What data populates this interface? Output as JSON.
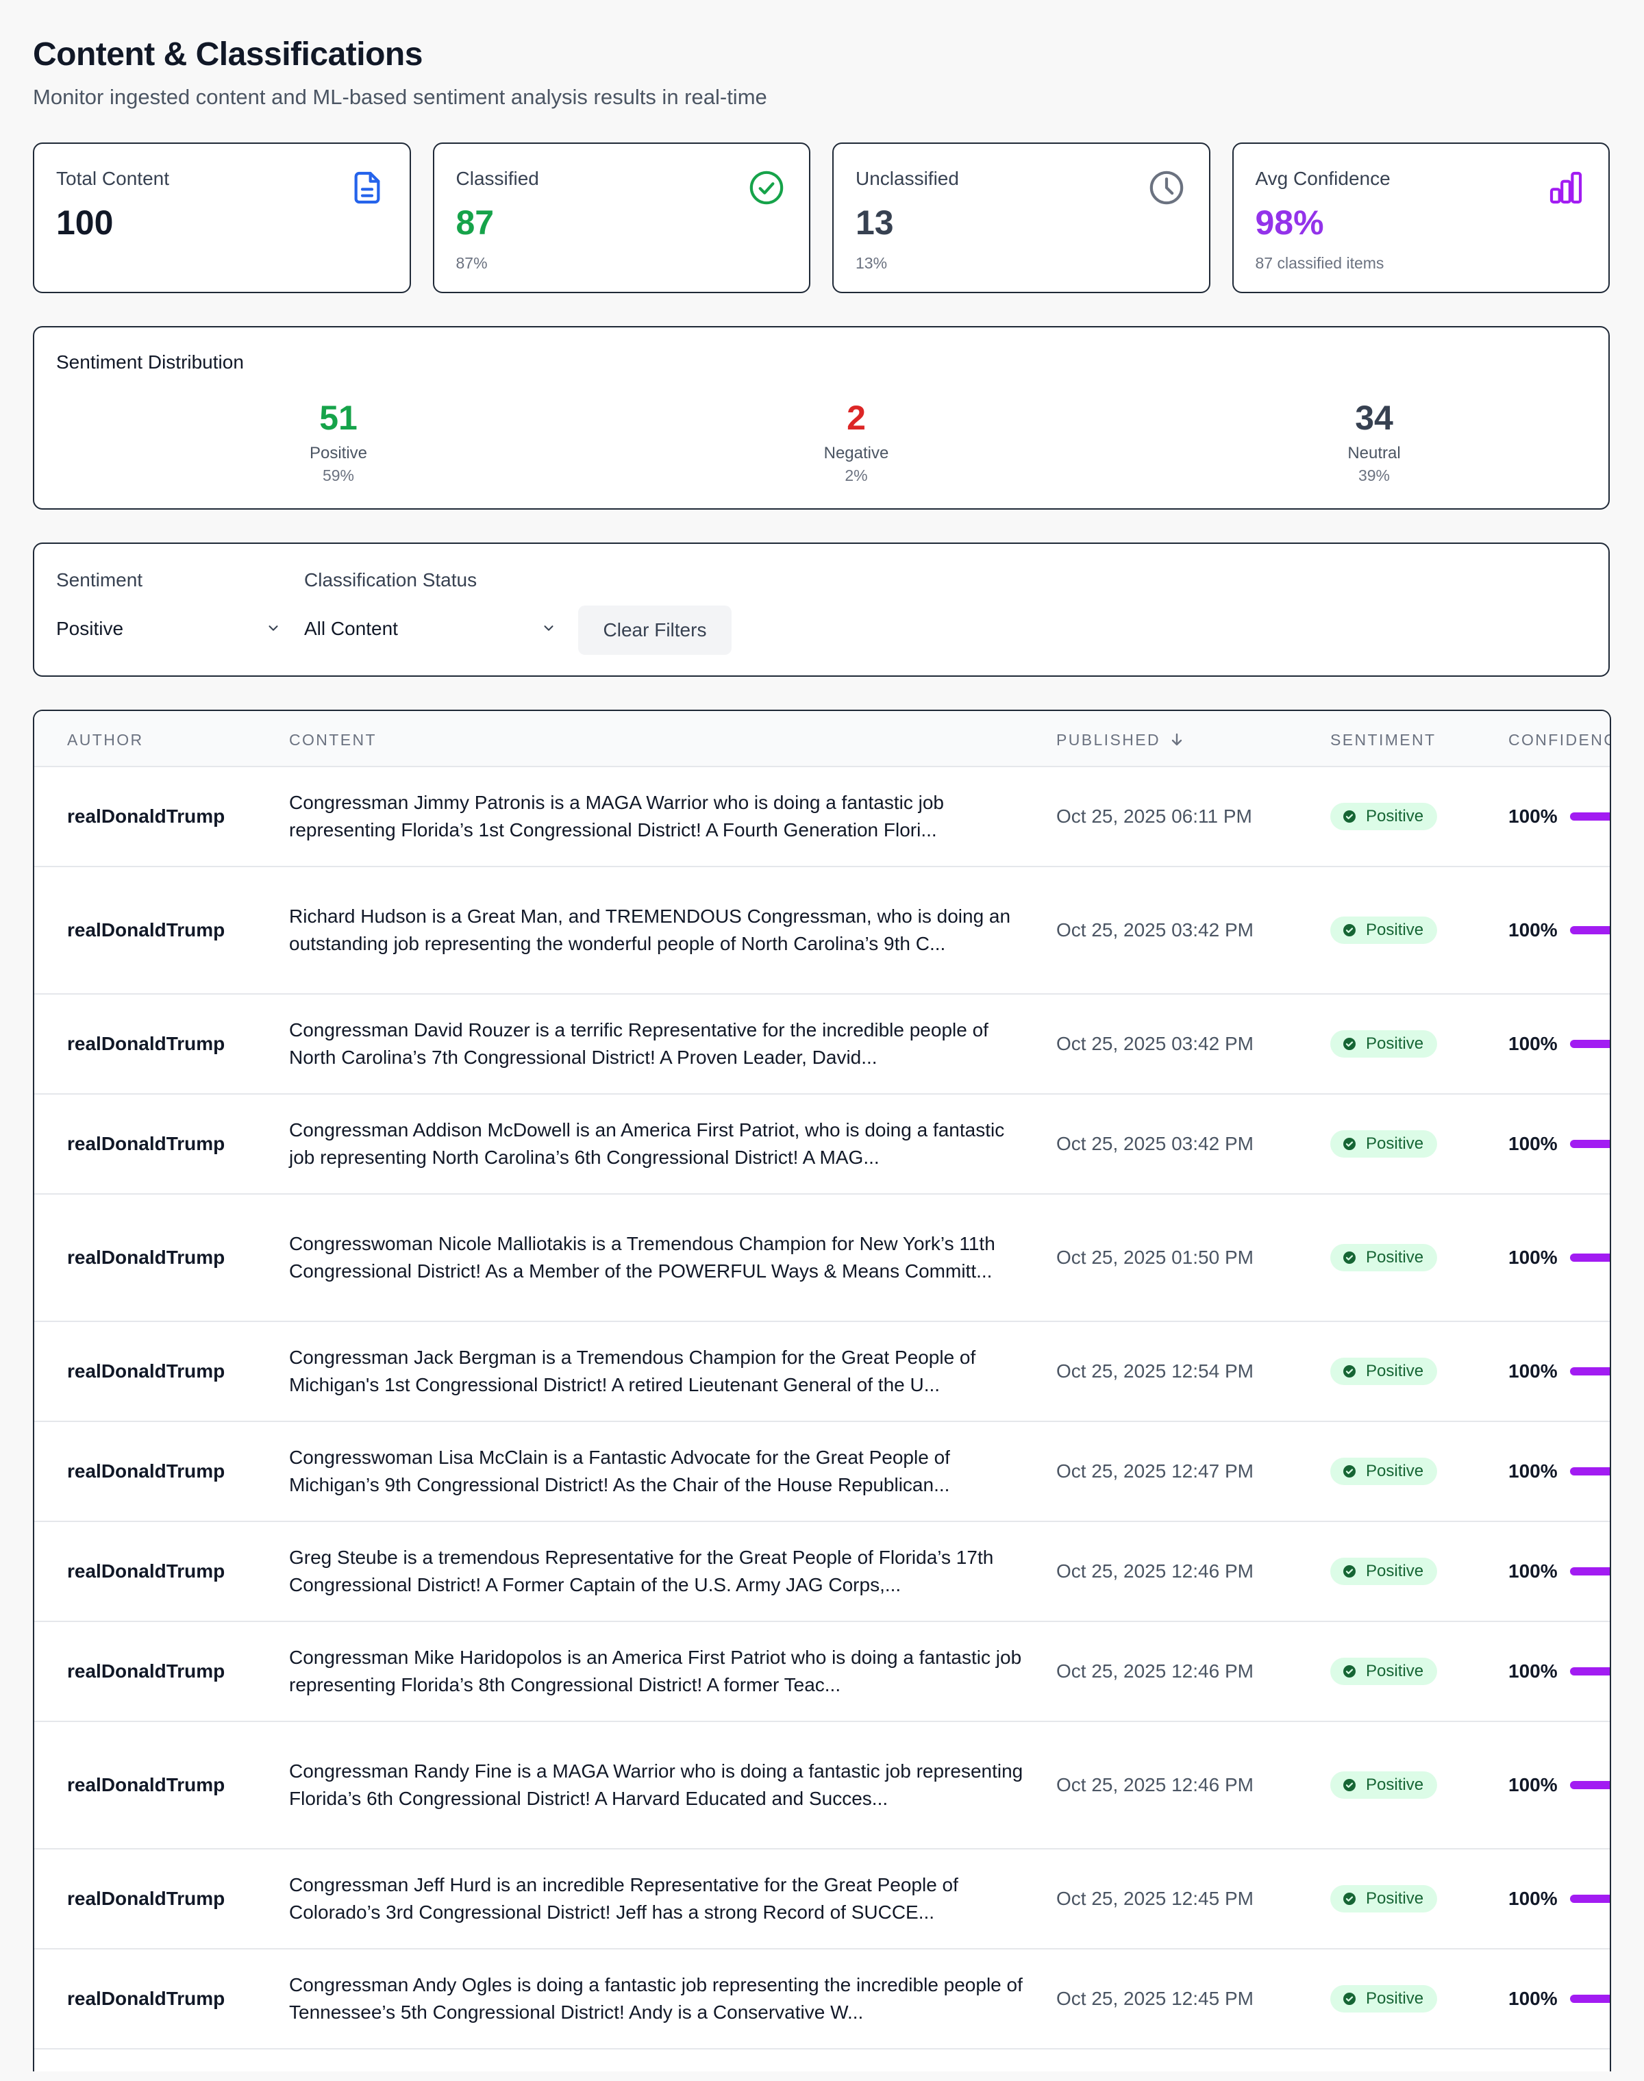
{
  "header": {
    "title": "Content & Classifications",
    "subtitle": "Monitor ingested content and ML-based sentiment analysis results in real-time"
  },
  "stats": [
    {
      "label": "Total Content",
      "value": "100",
      "sub": "",
      "color": "#111827",
      "icon": "document-icon"
    },
    {
      "label": "Classified",
      "value": "87",
      "sub": "87%",
      "color": "#16a34a",
      "icon": "check-circle-icon"
    },
    {
      "label": "Unclassified",
      "value": "13",
      "sub": "13%",
      "color": "#374151",
      "icon": "clock-icon"
    },
    {
      "label": "Avg Confidence",
      "value": "98%",
      "sub": "87 classified items",
      "color": "#9333ea",
      "icon": "bar-chart-icon"
    }
  ],
  "distribution": {
    "title": "Sentiment Distribution",
    "items": [
      {
        "value": "51",
        "label": "Positive",
        "pct": "59%",
        "color": "#16a34a"
      },
      {
        "value": "2",
        "label": "Negative",
        "pct": "2%",
        "color": "#dc2626"
      },
      {
        "value": "34",
        "label": "Neutral",
        "pct": "39%",
        "color": "#374151"
      }
    ]
  },
  "filters": {
    "sentiment_label": "Sentiment",
    "sentiment_value": "Positive",
    "status_label": "Classification Status",
    "status_value": "All Content",
    "clear_label": "Clear Filters"
  },
  "table": {
    "columns": {
      "author": "AUTHOR",
      "content": "CONTENT",
      "published": "PUBLISHED",
      "sentiment": "SENTIMENT",
      "confidence": "CONFIDENCE"
    },
    "rows": [
      {
        "author": "realDonaldTrump",
        "content": "Congressman Jimmy Patronis is a MAGA Warrior who is doing a fantastic job representing Florida’s 1st Congressional District! A Fourth Generation Flori...",
        "published": "Oct 25, 2025 06:11 PM",
        "sentiment": "Positive",
        "confidence": "100%"
      },
      {
        "author": "realDonaldTrump",
        "content": "Richard Hudson is a Great Man, and TREMENDOUS Congressman, who is doing an outstanding job representing the wonderful people of North Carolina’s 9th C...",
        "published": "Oct 25, 2025 03:42 PM",
        "sentiment": "Positive",
        "confidence": "100%"
      },
      {
        "author": "realDonaldTrump",
        "content": "Congressman David Rouzer is a terrific Representative for the incredible people of North Carolina’s 7th Congressional District! A Proven Leader, David...",
        "published": "Oct 25, 2025 03:42 PM",
        "sentiment": "Positive",
        "confidence": "100%"
      },
      {
        "author": "realDonaldTrump",
        "content": "Congressman Addison McDowell is an America First Patriot, who is doing a fantastic job representing North Carolina’s 6th Congressional District! A MAG...",
        "published": "Oct 25, 2025 03:42 PM",
        "sentiment": "Positive",
        "confidence": "100%"
      },
      {
        "author": "realDonaldTrump",
        "content": "Congresswoman Nicole Malliotakis is a Tremendous Champion for New York’s 11th Congressional District! As a Member of the POWERFUL Ways & Means Committ...",
        "published": "Oct 25, 2025 01:50 PM",
        "sentiment": "Positive",
        "confidence": "100%"
      },
      {
        "author": "realDonaldTrump",
        "content": "Congressman Jack Bergman is a Tremendous Champion for the Great People of Michigan's 1st Congressional District! A retired Lieutenant General of the U...",
        "published": "Oct 25, 2025 12:54 PM",
        "sentiment": "Positive",
        "confidence": "100%"
      },
      {
        "author": "realDonaldTrump",
        "content": "Congresswoman Lisa McClain is a Fantastic Advocate for the Great People of Michigan’s 9th Congressional District! As the Chair of the House Republican...",
        "published": "Oct 25, 2025 12:47 PM",
        "sentiment": "Positive",
        "confidence": "100%"
      },
      {
        "author": "realDonaldTrump",
        "content": "Greg Steube is a tremendous Representative for the Great People of Florida’s 17th Congressional District! A Former Captain of the U.S. Army JAG Corps,...",
        "published": "Oct 25, 2025 12:46 PM",
        "sentiment": "Positive",
        "confidence": "100%"
      },
      {
        "author": "realDonaldTrump",
        "content": "Congressman Mike Haridopolos is an America First Patriot who is doing a fantastic job representing Florida’s 8th Congressional District! A former Teac...",
        "published": "Oct 25, 2025 12:46 PM",
        "sentiment": "Positive",
        "confidence": "100%"
      },
      {
        "author": "realDonaldTrump",
        "content": "Congressman Randy Fine is a MAGA Warrior who is doing a fantastic job representing Florida’s 6th Congressional District! A Harvard Educated and Succes...",
        "published": "Oct 25, 2025 12:46 PM",
        "sentiment": "Positive",
        "confidence": "100%"
      },
      {
        "author": "realDonaldTrump",
        "content": "Congressman Jeff Hurd is an incredible Representative for the Great People of Colorado’s 3rd Congressional District! Jeff has a strong Record of SUCCE...",
        "published": "Oct 25, 2025 12:45 PM",
        "sentiment": "Positive",
        "confidence": "100%"
      },
      {
        "author": "realDonaldTrump",
        "content": "Congressman Andy Ogles is doing a fantastic job representing the incredible people of Tennessee’s 5th Congressional District! Andy is a Conservative W...",
        "published": "Oct 25, 2025 12:45 PM",
        "sentiment": "Positive",
        "confidence": "100%"
      }
    ]
  }
}
